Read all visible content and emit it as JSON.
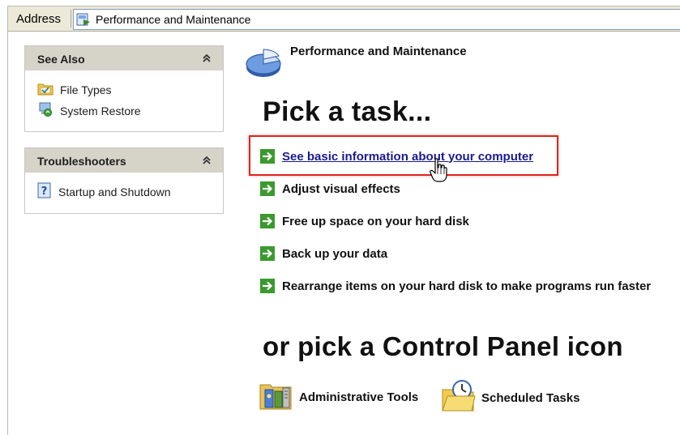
{
  "address": {
    "label": "Address",
    "value": "Performance and Maintenance"
  },
  "sidebar": {
    "see_also": {
      "title": "See Also",
      "items": [
        {
          "label": "File Types",
          "icon": "file-types-icon"
        },
        {
          "label": "System Restore",
          "icon": "system-restore-icon"
        }
      ]
    },
    "troubleshooters": {
      "title": "Troubleshooters",
      "items": [
        {
          "label": "Startup and Shutdown",
          "icon": "help-icon"
        }
      ]
    }
  },
  "main": {
    "category_title": "Performance and Maintenance",
    "pick_task_heading": "Pick a task...",
    "tasks": [
      {
        "label": "See basic information about your computer",
        "hovered": true
      },
      {
        "label": "Adjust visual effects"
      },
      {
        "label": "Free up space on your hard disk"
      },
      {
        "label": "Back up your data"
      },
      {
        "label": "Rearrange items on your hard disk to make programs run faster"
      }
    ],
    "pick_icon_heading": "or pick a Control Panel icon",
    "control_panel_icons": [
      {
        "label": "Administrative Tools",
        "icon": "administrative-tools-icon"
      },
      {
        "label": "Scheduled Tasks",
        "icon": "scheduled-tasks-icon"
      }
    ]
  },
  "colors": {
    "highlight_border": "#e0241c",
    "link": "#1a1a8c",
    "panel_header": "#d6d3c9",
    "task_arrow": "#3a9a2e"
  }
}
